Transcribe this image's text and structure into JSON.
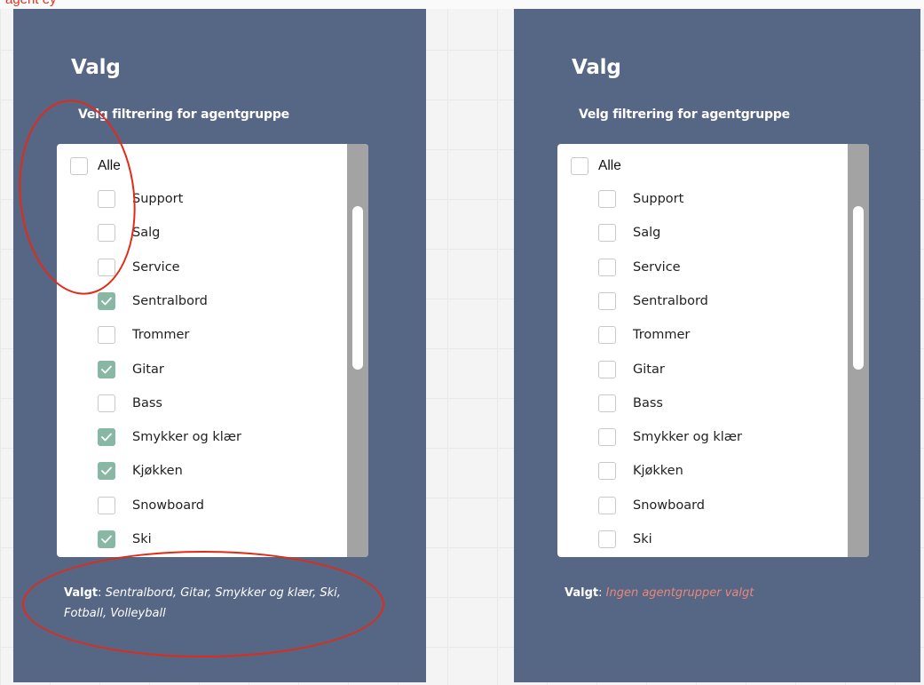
{
  "top_text": "agent ey",
  "colors": {
    "panel": "#566685",
    "checkbox_checked": "#88b8a3",
    "scrollbar": "#a3a3a3",
    "annotation": "#e32a16",
    "none_selected": "#e9877a"
  },
  "icons": {
    "check": "check-icon"
  },
  "panels": [
    {
      "title": "Valg",
      "subtitle": "Velg filtrering for agentgruppe",
      "all_label": "Alle",
      "all_checked": false,
      "options": [
        {
          "label": "Support",
          "checked": false
        },
        {
          "label": "Salg",
          "checked": false
        },
        {
          "label": "Service",
          "checked": false
        },
        {
          "label": "Sentralbord",
          "checked": true
        },
        {
          "label": "Trommer",
          "checked": false
        },
        {
          "label": "Gitar",
          "checked": true
        },
        {
          "label": "Bass",
          "checked": false
        },
        {
          "label": "Smykker og klær",
          "checked": true
        },
        {
          "label": "Kjøkken",
          "checked": true
        },
        {
          "label": "Snowboard",
          "checked": false
        },
        {
          "label": "Ski",
          "checked": true
        }
      ],
      "selected_label": "Valgt",
      "selected_sep": ": ",
      "selected_value": "Sentralbord, Gitar, Smykker og klær, Ski, Fotball, Volleyball",
      "selected_none": false
    },
    {
      "title": "Valg",
      "subtitle": "Velg filtrering for agentgruppe",
      "all_label": "Alle",
      "all_checked": false,
      "options": [
        {
          "label": "Support",
          "checked": false
        },
        {
          "label": "Salg",
          "checked": false
        },
        {
          "label": "Service",
          "checked": false
        },
        {
          "label": "Sentralbord",
          "checked": false
        },
        {
          "label": "Trommer",
          "checked": false
        },
        {
          "label": "Gitar",
          "checked": false
        },
        {
          "label": "Bass",
          "checked": false
        },
        {
          "label": "Smykker og klær",
          "checked": false
        },
        {
          "label": "Kjøkken",
          "checked": false
        },
        {
          "label": "Snowboard",
          "checked": false
        },
        {
          "label": "Ski",
          "checked": false
        }
      ],
      "selected_label": "Valgt",
      "selected_sep": ": ",
      "selected_value": "Ingen agentgrupper valgt",
      "selected_none": true
    }
  ]
}
